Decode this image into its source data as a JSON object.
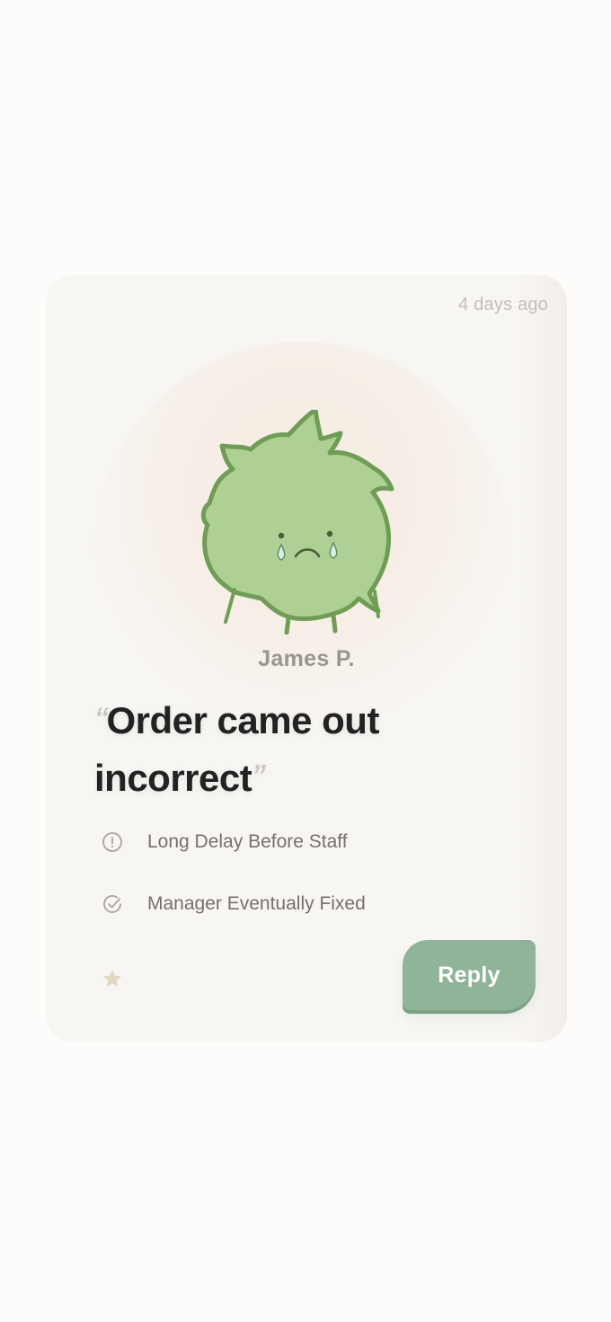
{
  "review": {
    "timestamp": "4 days ago",
    "author": "James P.",
    "quote": "Order came out incorrect",
    "quote_open": "“",
    "quote_close": "”",
    "tags": [
      {
        "icon": "alert-circle-icon",
        "label": "Long Delay Before Staff"
      },
      {
        "icon": "check-circle-icon",
        "label": "Manager Eventually Fixed"
      }
    ],
    "star_icon": "star-icon",
    "reply_label": "Reply",
    "mascot_icon": "sad-crying-mascot-icon"
  },
  "colors": {
    "mascot_fill": "#afd095",
    "mascot_outline": "#6f9d55",
    "reply_button": "#8fb49a",
    "star": "#e2d6bf",
    "card_bg": "#f8f6f3"
  }
}
